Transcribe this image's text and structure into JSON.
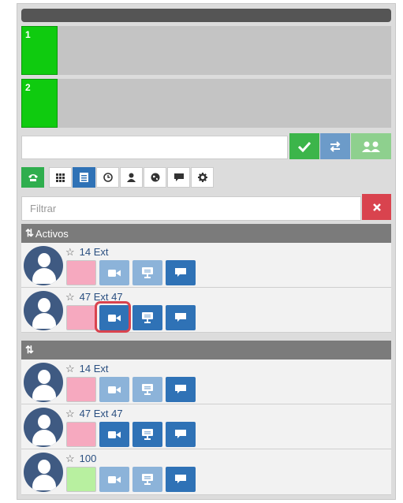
{
  "lines": [
    {
      "number": "1"
    },
    {
      "number": "2"
    }
  ],
  "colors": {
    "line_active": "#0fcb0f",
    "confirm": "#3cb54a",
    "transfer": "#6c9bc9",
    "conference": "#8ed08e",
    "clear": "#d9434e",
    "tab_active": "#2f72b6",
    "tab_phone": "#2fae4e",
    "status_pink": "#f6a9bf",
    "status_green": "#b8f0a0"
  },
  "tabs": [
    {
      "icon": "phone-icon"
    },
    {
      "icon": "dialpad-icon"
    },
    {
      "icon": "list-icon",
      "active": true
    },
    {
      "icon": "history-icon"
    },
    {
      "icon": "user-icon"
    },
    {
      "icon": "globe-icon"
    },
    {
      "icon": "chat-icon"
    },
    {
      "icon": "settings-icon"
    }
  ],
  "filter": {
    "placeholder": "Filtrar"
  },
  "sections": {
    "active": {
      "title": "Activos"
    },
    "all": {
      "title": ""
    }
  },
  "active_contacts": [
    {
      "name": "14 Ext",
      "status": "pink",
      "video": "light",
      "screen": "light",
      "chat": "dark"
    },
    {
      "name": "47 Ext 47",
      "status": "pink",
      "video": "dark",
      "screen": "dark",
      "chat": "dark"
    }
  ],
  "all_contacts": [
    {
      "name": "14 Ext",
      "status": "pink",
      "video": "light",
      "screen": "light",
      "chat": "dark"
    },
    {
      "name": "47 Ext 47",
      "status": "pink",
      "video": "dark",
      "screen": "dark",
      "chat": "dark"
    },
    {
      "name": "100",
      "status": "green",
      "video": "light",
      "screen": "light",
      "chat": "dark"
    }
  ]
}
